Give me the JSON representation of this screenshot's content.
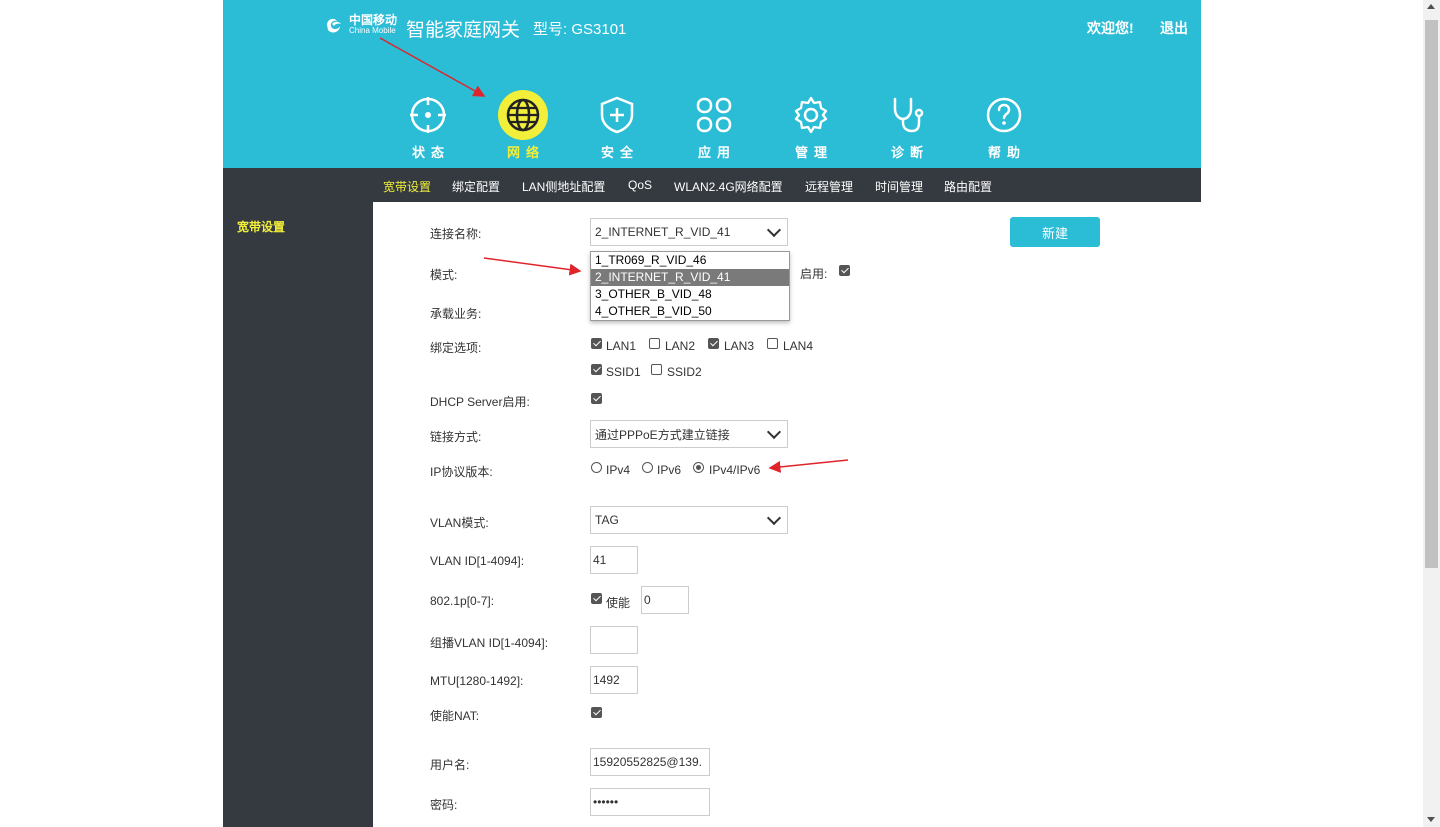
{
  "header": {
    "logo_cn": "中国移动",
    "logo_en": "China Mobile",
    "product": "智能家庭网关",
    "model": "型号: GS3101",
    "welcome": "欢迎您!",
    "logout": "退出"
  },
  "main_nav": [
    {
      "label": "状态",
      "icon": "target-icon",
      "active": false
    },
    {
      "label": "网络",
      "icon": "globe-icon",
      "active": true
    },
    {
      "label": "安全",
      "icon": "shield-icon",
      "active": false
    },
    {
      "label": "应用",
      "icon": "apps-icon",
      "active": false
    },
    {
      "label": "管理",
      "icon": "gear-icon",
      "active": false
    },
    {
      "label": "诊断",
      "icon": "stethoscope-icon",
      "active": false
    },
    {
      "label": "帮助",
      "icon": "help-icon",
      "active": false
    }
  ],
  "sub_nav": [
    {
      "label": "宽带设置",
      "active": true
    },
    {
      "label": "绑定配置"
    },
    {
      "label": "LAN侧地址配置"
    },
    {
      "label": "QoS"
    },
    {
      "label": "WLAN2.4G网络配置"
    },
    {
      "label": "远程管理"
    },
    {
      "label": "时间管理"
    },
    {
      "label": "路由配置"
    }
  ],
  "sidebar": {
    "items": [
      {
        "label": "宽带设置"
      }
    ]
  },
  "form": {
    "connection_name": {
      "label": "连接名称:",
      "value": "2_INTERNET_R_VID_41",
      "options": [
        "1_TR069_R_VID_46",
        "2_INTERNET_R_VID_41",
        "3_OTHER_B_VID_48",
        "4_OTHER_B_VID_50"
      ]
    },
    "new_button": "新建",
    "mode": {
      "label": "模式:"
    },
    "enable": {
      "label": "启用:",
      "checked": true
    },
    "service": {
      "label": "承载业务:"
    },
    "bind": {
      "label": "绑定选项:",
      "options": [
        {
          "label": "LAN1",
          "checked": true
        },
        {
          "label": "LAN2",
          "checked": false
        },
        {
          "label": "LAN3",
          "checked": true
        },
        {
          "label": "LAN4",
          "checked": false
        },
        {
          "label": "SSID1",
          "checked": true
        },
        {
          "label": "SSID2",
          "checked": false
        }
      ]
    },
    "dhcp": {
      "label": "DHCP Server启用:",
      "checked": true
    },
    "link_mode": {
      "label": "链接方式:",
      "value": "通过PPPoE方式建立链接"
    },
    "ip_version": {
      "label": "IP协议版本:",
      "options": [
        "IPv4",
        "IPv6",
        "IPv4/IPv6"
      ],
      "selected": "IPv4/IPv6"
    },
    "vlan_mode": {
      "label": "VLAN模式:",
      "value": "TAG"
    },
    "vlan_id": {
      "label": "VLAN ID[1-4094]:",
      "value": "41"
    },
    "dot1p": {
      "label": "802.1p[0-7]:",
      "enable_label": "使能",
      "checked": true,
      "value": "0"
    },
    "multicast_vlan": {
      "label": "组播VLAN ID[1-4094]:",
      "value": ""
    },
    "mtu": {
      "label": "MTU[1280-1492]:",
      "value": "1492"
    },
    "nat": {
      "label": "使能NAT:",
      "checked": true
    },
    "username": {
      "label": "用户名:",
      "value": "15920552825@139."
    },
    "password": {
      "label": "密码:",
      "value": "••••••"
    }
  },
  "colors": {
    "header": "#2bbcd6",
    "dark": "#343a40",
    "accent": "#f2ef3a",
    "annotation": "#e0242b"
  }
}
